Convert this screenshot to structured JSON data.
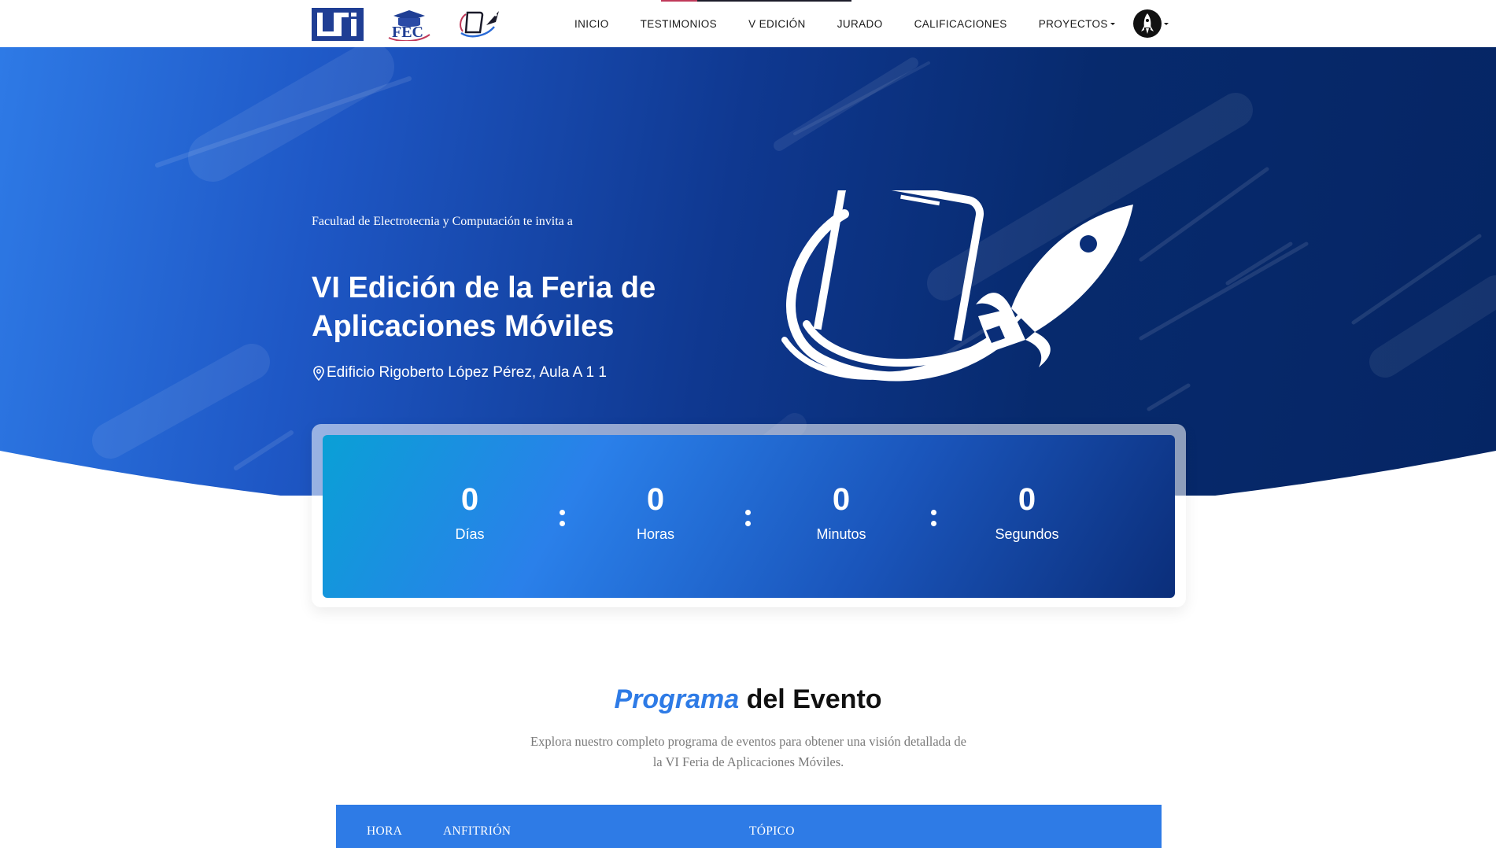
{
  "navbar": {
    "logos": [
      "uni-logo",
      "fec-logo",
      "feria-apps-logo"
    ],
    "links": [
      {
        "label": "INICIO"
      },
      {
        "label": "TESTIMONIOS"
      },
      {
        "label": "V EDICIÓN"
      },
      {
        "label": "JURADO"
      },
      {
        "label": "CALIFICACIONES"
      },
      {
        "label": "PROYECTOS",
        "dropdown": true
      }
    ],
    "user_icon": "rocket-avatar-icon"
  },
  "hero": {
    "invite": "Facultad de Electrotecnia y Computación te invita a",
    "title": "VI Edición de la Feria de Aplicaciones Móviles",
    "location": "Edificio Rigoberto López Pérez, Aula A 1 1",
    "location_icon": "map-pin-icon",
    "graphic_icon": "phone-rocket-icon"
  },
  "countdown": {
    "separator": ":",
    "units": [
      {
        "value": "0",
        "label": "Días"
      },
      {
        "value": "0",
        "label": "Horas"
      },
      {
        "value": "0",
        "label": "Minutos"
      },
      {
        "value": "0",
        "label": "Segundos"
      }
    ]
  },
  "program": {
    "title_accent": "Programa",
    "title_rest": " del Evento",
    "description": "Explora nuestro completo programa de eventos para obtener una visión detallada de la VI Feria de Aplicaciones Móviles.",
    "columns": [
      "HORA",
      "ANFITRIÓN",
      "TÓPICO"
    ]
  },
  "colors": {
    "accent": "#2e7be6",
    "hero_dark": "#052564",
    "hero_light": "#2e7ae6"
  }
}
